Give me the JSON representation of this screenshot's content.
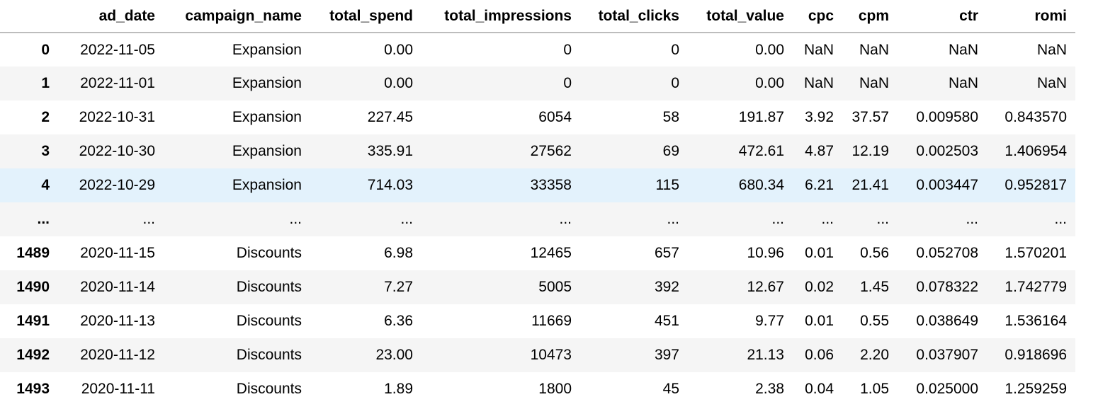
{
  "table": {
    "index_header": "",
    "columns": [
      "ad_date",
      "campaign_name",
      "total_spend",
      "total_impressions",
      "total_clicks",
      "total_value",
      "cpc",
      "cpm",
      "ctr",
      "romi"
    ],
    "rows": [
      {
        "index": "0",
        "cells": [
          "2022-11-05",
          "Expansion",
          "0.00",
          "0",
          "0",
          "0.00",
          "NaN",
          "NaN",
          "NaN",
          "NaN"
        ]
      },
      {
        "index": "1",
        "cells": [
          "2022-11-01",
          "Expansion",
          "0.00",
          "0",
          "0",
          "0.00",
          "NaN",
          "NaN",
          "NaN",
          "NaN"
        ]
      },
      {
        "index": "2",
        "cells": [
          "2022-10-31",
          "Expansion",
          "227.45",
          "6054",
          "58",
          "191.87",
          "3.92",
          "37.57",
          "0.009580",
          "0.843570"
        ]
      },
      {
        "index": "3",
        "cells": [
          "2022-10-30",
          "Expansion",
          "335.91",
          "27562",
          "69",
          "472.61",
          "4.87",
          "12.19",
          "0.002503",
          "1.406954"
        ]
      },
      {
        "index": "4",
        "cells": [
          "2022-10-29",
          "Expansion",
          "714.03",
          "33358",
          "115",
          "680.34",
          "6.21",
          "21.41",
          "0.003447",
          "0.952817"
        ]
      },
      {
        "index": "...",
        "cells": [
          "...",
          "...",
          "...",
          "...",
          "...",
          "...",
          "...",
          "...",
          "...",
          "..."
        ]
      },
      {
        "index": "1489",
        "cells": [
          "2020-11-15",
          "Discounts",
          "6.98",
          "12465",
          "657",
          "10.96",
          "0.01",
          "0.56",
          "0.052708",
          "1.570201"
        ]
      },
      {
        "index": "1490",
        "cells": [
          "2020-11-14",
          "Discounts",
          "7.27",
          "5005",
          "392",
          "12.67",
          "0.02",
          "1.45",
          "0.078322",
          "1.742779"
        ]
      },
      {
        "index": "1491",
        "cells": [
          "2020-11-13",
          "Discounts",
          "6.36",
          "11669",
          "451",
          "9.77",
          "0.01",
          "0.55",
          "0.038649",
          "1.536164"
        ]
      },
      {
        "index": "1492",
        "cells": [
          "2020-11-12",
          "Discounts",
          "23.00",
          "10473",
          "397",
          "21.13",
          "0.06",
          "2.20",
          "0.037907",
          "0.918696"
        ]
      },
      {
        "index": "1493",
        "cells": [
          "2020-11-11",
          "Discounts",
          "1.89",
          "1800",
          "45",
          "2.38",
          "0.04",
          "1.05",
          "0.025000",
          "1.259259"
        ]
      }
    ],
    "hovered_row": "4",
    "colors": {
      "header_border": "#bdbdbd",
      "stripe": "#f5f5f5",
      "hover": "#e3f2fc"
    }
  }
}
